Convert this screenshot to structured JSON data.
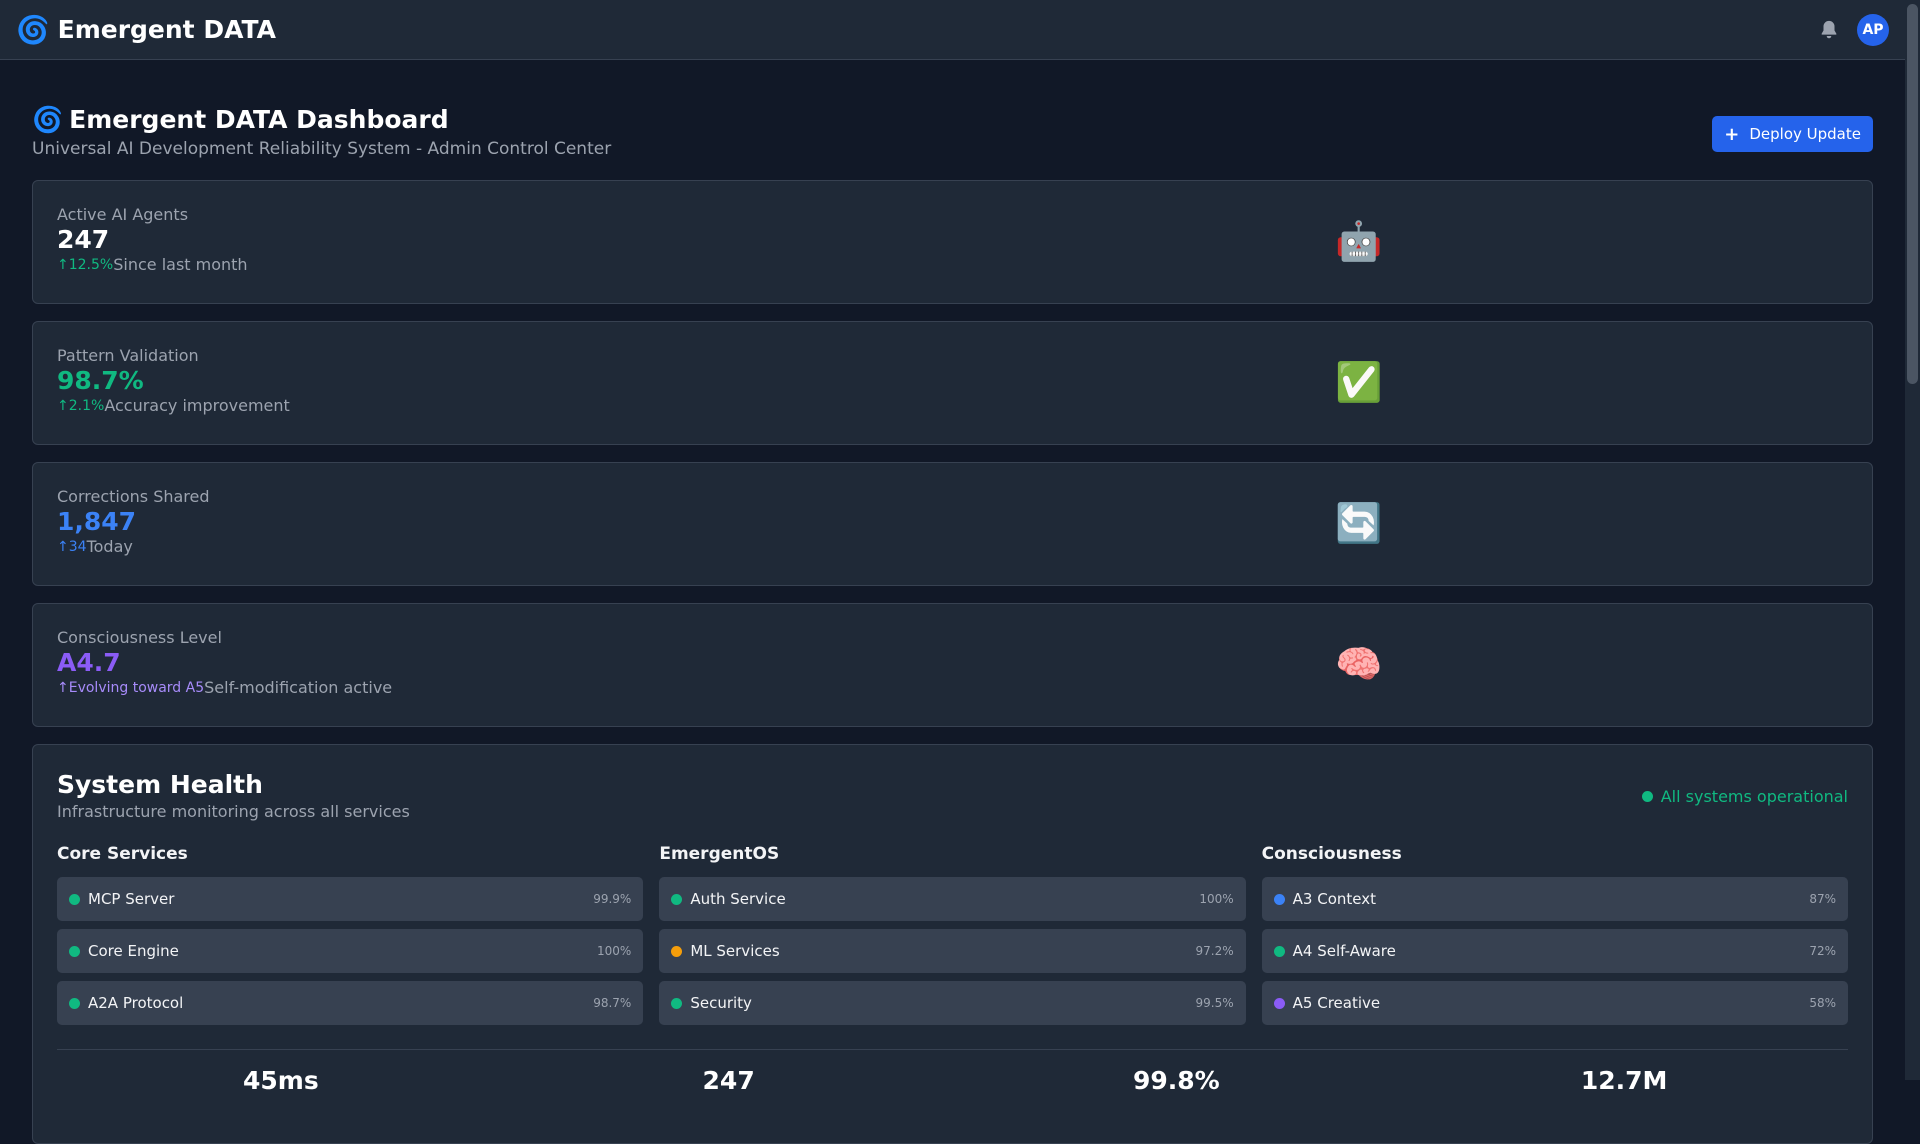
{
  "topbar": {
    "brand_icon": "🌀",
    "brand_name": "Emergent DATA",
    "bell_icon": "bell-icon",
    "avatar_initials": "AP"
  },
  "header": {
    "icon": "🌀",
    "title": "Emergent DATA Dashboard",
    "subtitle": "Universal AI Development Reliability System - Admin Control Center",
    "deploy_button": "Deploy Update",
    "deploy_icon": "+"
  },
  "stats": [
    {
      "label": "Active AI Agents",
      "value": "247",
      "value_color": "#ffffff",
      "arrow": "↑",
      "change": "12.5%",
      "change_color": "#10b981",
      "note": "Since last month",
      "emoji": "🤖"
    },
    {
      "label": "Pattern Validation",
      "value": "98.7%",
      "value_color": "#10b981",
      "arrow": "↑",
      "change": "2.1%",
      "change_color": "#10b981",
      "note": "Accuracy improvement",
      "emoji": "✅"
    },
    {
      "label": "Corrections Shared",
      "value": "1,847",
      "value_color": "#3b82f6",
      "arrow": "↑",
      "change": "34",
      "change_color": "#3b82f6",
      "note": "Today",
      "emoji": "🔄"
    },
    {
      "label": "Consciousness Level",
      "value": "A4.7",
      "value_color": "#8b5cf6",
      "arrow": "↑",
      "change": "Evolving toward A5",
      "change_color": "#a78bfa",
      "note": "Self-modification active",
      "emoji": "🧠"
    }
  ],
  "health": {
    "title": "System Health",
    "subtitle": "Infrastructure monitoring across all services",
    "status": "All systems operational",
    "groups": [
      {
        "title": "Core Services",
        "items": [
          {
            "name": "MCP Server",
            "value": "99.9%",
            "color": "#10b981"
          },
          {
            "name": "Core Engine",
            "value": "100%",
            "color": "#10b981"
          },
          {
            "name": "A2A Protocol",
            "value": "98.7%",
            "color": "#10b981"
          }
        ]
      },
      {
        "title": "EmergentOS",
        "items": [
          {
            "name": "Auth Service",
            "value": "100%",
            "color": "#10b981"
          },
          {
            "name": "ML Services",
            "value": "97.2%",
            "color": "#f59e0b"
          },
          {
            "name": "Security",
            "value": "99.5%",
            "color": "#10b981"
          }
        ]
      },
      {
        "title": "Consciousness",
        "items": [
          {
            "name": "A3 Context",
            "value": "87%",
            "color": "#3b82f6"
          },
          {
            "name": "A4 Self-Aware",
            "value": "72%",
            "color": "#10b981"
          },
          {
            "name": "A5 Creative",
            "value": "58%",
            "color": "#8b5cf6"
          }
        ]
      }
    ],
    "metrics": [
      "45ms",
      "247",
      "99.8%",
      "12.7M"
    ]
  }
}
